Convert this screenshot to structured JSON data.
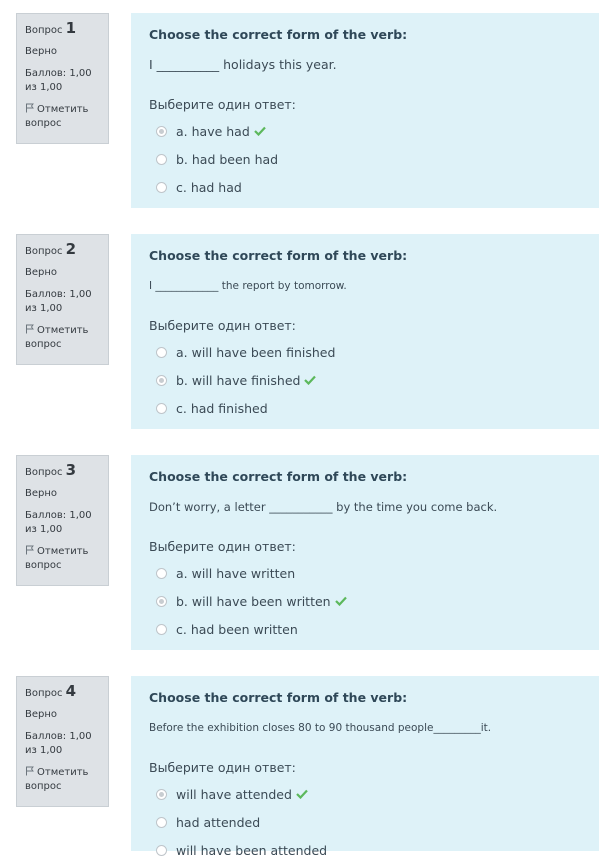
{
  "questions": [
    {
      "label": "Вопрос",
      "number": "1",
      "state": "Верно",
      "grade": "Баллов: 1,00 из 1,00",
      "flag": "Отметить вопрос",
      "title": "Choose the correct form of the verb:",
      "stem": "I __________ holidays this year.",
      "prompt": "Выберите один ответ:",
      "answers": [
        "a. have had",
        "b. had been had",
        "c. had had"
      ],
      "selected": 0,
      "correct": 0
    },
    {
      "label": "Вопрос",
      "number": "2",
      "state": "Верно",
      "grade": "Баллов: 1,00 из 1,00",
      "flag": "Отметить вопрос",
      "title": "Choose the correct form of the verb:",
      "stem": "I ____________ the report by tomorrow.",
      "prompt": "Выберите один ответ:",
      "answers": [
        "a. will have been finished",
        "b. will have finished",
        "c. had finished"
      ],
      "selected": 1,
      "correct": 1
    },
    {
      "label": "Вопрос",
      "number": "3",
      "state": "Верно",
      "grade": "Баллов: 1,00 из 1,00",
      "flag": "Отметить вопрос",
      "title": "Choose the correct form of the verb:",
      "stem": "Don’t worry, a letter ___________ by the time you come back.",
      "prompt": "Выберите один ответ:",
      "answers": [
        "a. will have written",
        "b. will have been written",
        "c. had been written"
      ],
      "selected": 1,
      "correct": 1
    },
    {
      "label": "Вопрос",
      "number": "4",
      "state": "Верно",
      "grade": "Баллов: 1,00 из 1,00",
      "flag": "Отметить вопрос",
      "title": "Choose the correct form of the verb:",
      "stem": "Before the exhibition closes 80 to 90 thousand people_________it.",
      "prompt": "Выберите один ответ:",
      "answers": [
        "will have attended",
        "had attended",
        "will have been attended"
      ],
      "selected": 0,
      "correct": 0
    }
  ],
  "colors": {
    "info_bg": "#dee2e6",
    "content_bg": "#def2f8",
    "title": "#2f4858",
    "check": "#5cb85c"
  }
}
